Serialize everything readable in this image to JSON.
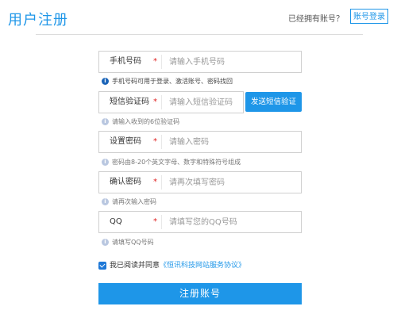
{
  "header": {
    "title": "用户注册",
    "have_account": "已经拥有账号？",
    "login_label": "账号登录"
  },
  "form": {
    "fields": [
      {
        "label": "手机号码",
        "required": "*",
        "placeholder": "请输入手机号码",
        "hint": "手机号码可用于登录、激活账号、密码找回"
      },
      {
        "label": "短信验证码",
        "required": "*",
        "placeholder": "请输入短信验证码",
        "hint": "请输入收到的6位验证码"
      },
      {
        "label": "设置密码",
        "required": "*",
        "placeholder": "请输入密码",
        "hint": "密码由8-20个英文字母、数字和特殊符号组成"
      },
      {
        "label": "确认密码",
        "required": "*",
        "placeholder": "请再次填写密码",
        "hint": "请再次输入密码"
      },
      {
        "label": "QQ",
        "required": "*",
        "placeholder": "请填写您的QQ号码",
        "hint": "请填写QQ号码"
      }
    ],
    "hint_icon": "i",
    "sms_button": "发送短信验证",
    "agreement": {
      "text": "我已阅读并同意",
      "link": "《恒讯科技网站服务协议》",
      "checked": true
    },
    "submit": "注册账号"
  },
  "colors": {
    "accent": "#1e96e8",
    "required": "#e02020",
    "info_icon_active": "#1a64b8"
  }
}
